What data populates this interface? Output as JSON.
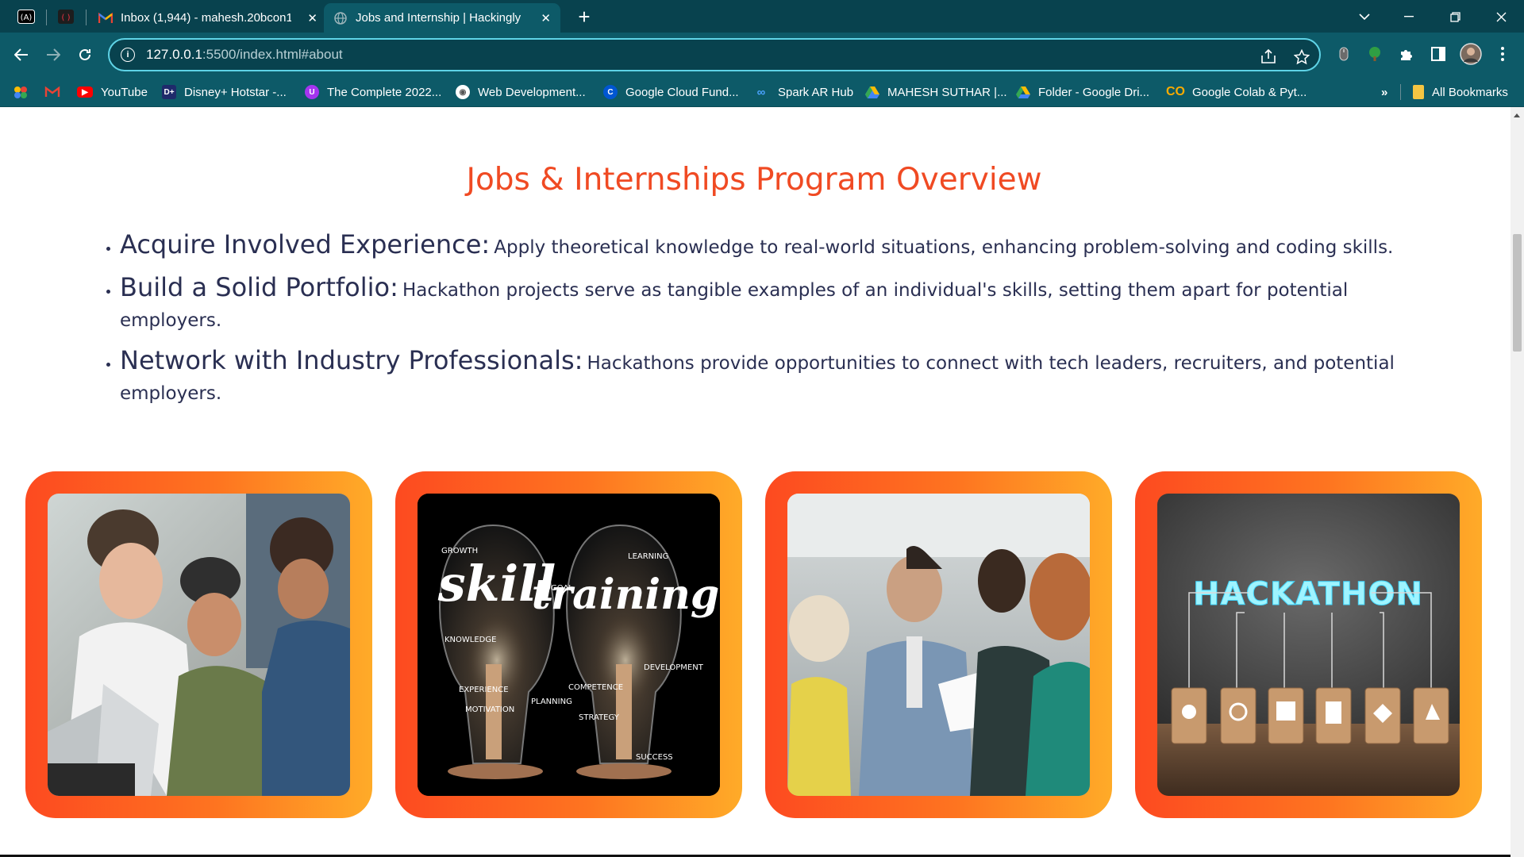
{
  "browser": {
    "tabs": [
      {
        "title": "Inbox (1,944) - mahesh.20bcon1",
        "favicon": "gmail-icon",
        "active": false
      },
      {
        "title": "Jobs and Internship | Hackingly",
        "favicon": "globe-icon",
        "active": true
      }
    ],
    "url_host": "127.0.0.1",
    "url_rest": ":5500/index.html#about",
    "bookmarks": [
      {
        "label": "YouTube",
        "icon": "youtube-icon",
        "color": "#ff0000"
      },
      {
        "label": "Disney+ Hotstar -...",
        "icon": "hotstar-icon",
        "color": "#1f2a6b"
      },
      {
        "label": "The Complete 2022...",
        "icon": "udemy-icon",
        "color": "#a435f0"
      },
      {
        "label": "Web Development...",
        "icon": "course-icon",
        "color": "#ffffff"
      },
      {
        "label": "Google Cloud Fund...",
        "icon": "coursera-icon",
        "color": "#0056d2"
      },
      {
        "label": "Spark AR Hub",
        "icon": "meta-icon",
        "color": "#1877f2"
      },
      {
        "label": "MAHESH SUTHAR |...",
        "icon": "drive-icon",
        "color": "#34a853"
      },
      {
        "label": "Folder - Google Dri...",
        "icon": "drive-icon",
        "color": "#fbbc04"
      },
      {
        "label": "Google Colab & Pyt...",
        "icon": "colab-icon",
        "color": "#f9ab00"
      }
    ],
    "bookmarks_overflow": "»",
    "all_bookmarks": "All Bookmarks"
  },
  "page": {
    "heading": "Jobs & Internships Program Overview",
    "points": [
      {
        "lead": "Acquire Involved Experience:",
        "desc": "Apply theoretical knowledge to real-world situations, enhancing problem-solving and coding skills."
      },
      {
        "lead": "Build a Solid Portfolio:",
        "desc": "Hackathon projects serve as tangible examples of an individual's skills, setting them apart for potential employers."
      },
      {
        "lead": "Network with Industry Professionals:",
        "desc": "Hackathons provide opportunities to connect with tech leaders, recruiters, and potential employers."
      }
    ],
    "cards": [
      {
        "name": "students-laptop-photo"
      },
      {
        "name": "skill-training-bulbs-image"
      },
      {
        "name": "business-presentation-photo"
      },
      {
        "name": "hackathon-blocks-image"
      }
    ],
    "card_texts": {
      "skill": "skill",
      "training": "training",
      "hackathon": "HACKATHON",
      "words": [
        "GROWTH",
        "LEARNING",
        "GOAL",
        "KNOWLEDGE",
        "DEVELOPMENT",
        "EXPERIENCE",
        "COMPETENCE",
        "PLANNING",
        "MOTIVATION",
        "STRATEGY",
        "SUCCESS"
      ]
    }
  },
  "colors": {
    "tabbar": "#08424e",
    "toolbar": "#0d5a68",
    "heading": "#f04a23",
    "text": "#2a2f52",
    "card_gradient_start": "#fd4a20",
    "card_gradient_end": "#ffab28"
  }
}
